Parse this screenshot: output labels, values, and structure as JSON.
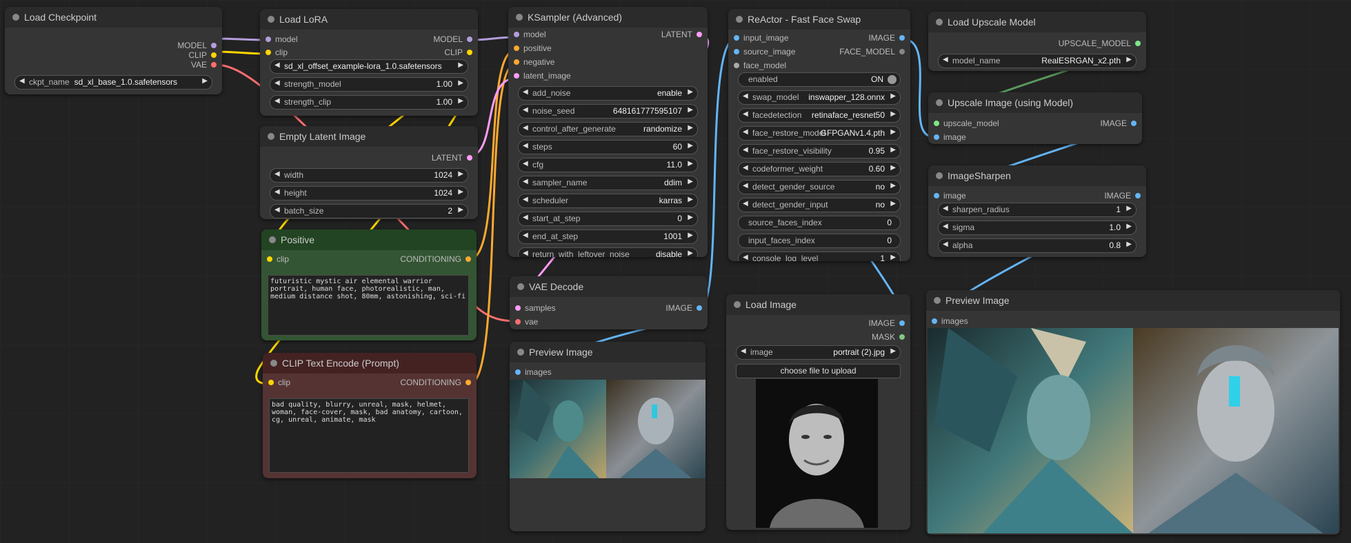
{
  "nodes": {
    "load_checkpoint": {
      "title": "Load Checkpoint",
      "out_model": "MODEL",
      "out_clip": "CLIP",
      "out_vae": "VAE",
      "ckpt_label": "ckpt_name",
      "ckpt_value": "sd_xl_base_1.0.safetensors"
    },
    "load_lora": {
      "title": "Load LoRA",
      "in_model": "model",
      "in_clip": "clip",
      "out_model": "MODEL",
      "out_clip": "CLIP",
      "lora_name": "sd_xl_offset_example-lora_1.0.safetensors",
      "strength_model_label": "strength_model",
      "strength_model": "1.00",
      "strength_clip_label": "strength_clip",
      "strength_clip": "1.00"
    },
    "empty_latent": {
      "title": "Empty Latent Image",
      "out_latent": "LATENT",
      "width_label": "width",
      "width": "1024",
      "height_label": "height",
      "height": "1024",
      "batch_label": "batch_size",
      "batch": "2"
    },
    "positive": {
      "title": "Positive",
      "in_clip": "clip",
      "out_cond": "CONDITIONING",
      "text": "futuristic mystic air elemental warrior portrait, human face, photorealistic, man, medium distance shot, 80mm, astonishing, sci-fi"
    },
    "clip_text_encode": {
      "title": "CLIP Text Encode (Prompt)",
      "in_clip": "clip",
      "out_cond": "CONDITIONING",
      "text": "bad quality, blurry, unreal, mask, helmet, woman, face-cover, mask, bad anatomy, cartoon, cg, unreal, animate, mask"
    },
    "ksampler": {
      "title": "KSampler (Advanced)",
      "in_model": "model",
      "in_positive": "positive",
      "in_negative": "negative",
      "in_latent": "latent_image",
      "out_latent": "LATENT",
      "widgets": [
        {
          "label": "add_noise",
          "value": "enable"
        },
        {
          "label": "noise_seed",
          "value": "648161777595107"
        },
        {
          "label": "control_after_generate",
          "value": "randomize"
        },
        {
          "label": "steps",
          "value": "60"
        },
        {
          "label": "cfg",
          "value": "11.0"
        },
        {
          "label": "sampler_name",
          "value": "ddim"
        },
        {
          "label": "scheduler",
          "value": "karras"
        },
        {
          "label": "start_at_step",
          "value": "0"
        },
        {
          "label": "end_at_step",
          "value": "1001"
        },
        {
          "label": "return_with_leftover_noise",
          "value": "disable"
        }
      ]
    },
    "vae_decode": {
      "title": "VAE Decode",
      "in_samples": "samples",
      "in_vae": "vae",
      "out_image": "IMAGE"
    },
    "preview_left": {
      "title": "Preview Image",
      "in_images": "images"
    },
    "reactor": {
      "title": "ReActor - Fast Face Swap",
      "in_input_image": "input_image",
      "in_source_image": "source_image",
      "in_face_model": "face_model",
      "out_image": "IMAGE",
      "out_face_model": "FACE_MODEL",
      "enabled_label": "enabled",
      "enabled_value": "ON",
      "widgets": [
        {
          "label": "swap_model",
          "value": "inswapper_128.onnx"
        },
        {
          "label": "facedetection",
          "value": "retinaface_resnet50"
        },
        {
          "label": "face_restore_model",
          "value": "GFPGANv1.4.pth"
        },
        {
          "label": "face_restore_visibility",
          "value": "0.95"
        },
        {
          "label": "codeformer_weight",
          "value": "0.60"
        },
        {
          "label": "detect_gender_source",
          "value": "no"
        },
        {
          "label": "detect_gender_input",
          "value": "no"
        }
      ],
      "plain_widgets": [
        {
          "label": "source_faces_index",
          "value": "0"
        },
        {
          "label": "input_faces_index",
          "value": "0"
        }
      ],
      "console_label": "console_log_level",
      "console_value": "1"
    },
    "load_image": {
      "title": "Load Image",
      "out_image": "IMAGE",
      "out_mask": "MASK",
      "image_label": "image",
      "image_value": "portrait (2).jpg",
      "upload_label": "choose file to upload"
    },
    "load_upscale": {
      "title": "Load Upscale Model",
      "out_upscale": "UPSCALE_MODEL",
      "model_label": "model_name",
      "model_value": "RealESRGAN_x2.pth"
    },
    "upscale_image": {
      "title": "Upscale Image (using Model)",
      "in_upscale": "upscale_model",
      "in_image": "image",
      "out_image": "IMAGE"
    },
    "image_sharpen": {
      "title": "ImageSharpen",
      "in_image": "image",
      "out_image": "IMAGE",
      "radius_label": "sharpen_radius",
      "radius": "1",
      "sigma_label": "sigma",
      "sigma": "1.0",
      "alpha_label": "alpha",
      "alpha": "0.8"
    },
    "preview_right": {
      "title": "Preview Image",
      "in_images": "images"
    }
  },
  "colors": {
    "model": "#b39ddb",
    "clip": "#ffd500",
    "vae": "#ff6e6e",
    "conditioning": "#ffa931",
    "latent": "#ff9cf9",
    "image": "#64b5f6",
    "upscale_model": "#7ee787",
    "canvas": "#222222"
  }
}
